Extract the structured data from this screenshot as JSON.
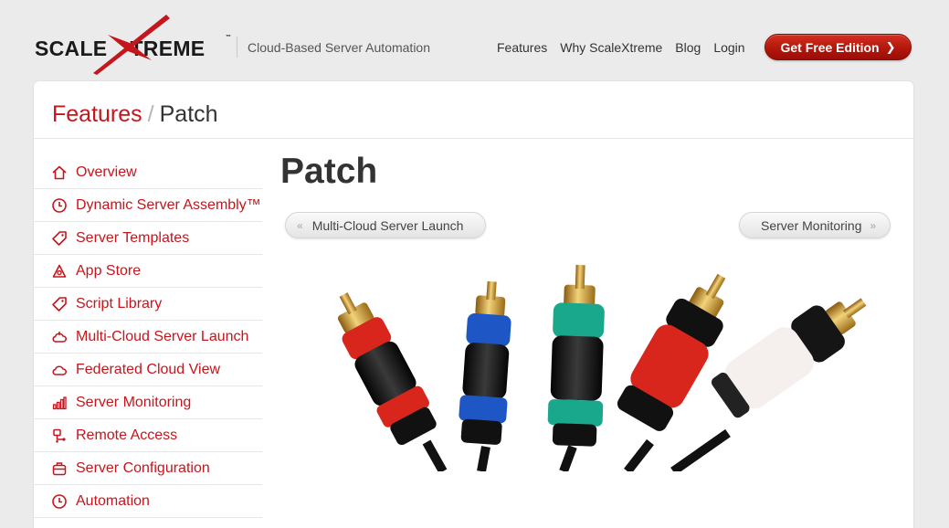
{
  "brand": {
    "name_left": "SCALE",
    "name_right": "TREME",
    "tm": "™",
    "accent_color": "#c4161c",
    "tagline": "Cloud-Based Server Automation"
  },
  "topnav": {
    "items": [
      "Features",
      "Why ScaleXtreme",
      "Blog",
      "Login"
    ],
    "cta_label": "Get Free Edition",
    "cta_icon": "chevron-right-icon"
  },
  "breadcrumb": {
    "parent": "Features",
    "separator": "/",
    "current": "Patch"
  },
  "sidebar": {
    "items": [
      {
        "label": "Overview",
        "icon": "home-icon"
      },
      {
        "label": "Dynamic Server Assembly™",
        "icon": "clock-icon"
      },
      {
        "label": "Server Templates",
        "icon": "tag-icon"
      },
      {
        "label": "App Store",
        "icon": "apps-icon"
      },
      {
        "label": "Script Library",
        "icon": "tag-icon"
      },
      {
        "label": "Multi-Cloud Server Launch",
        "icon": "cloud-launch-icon"
      },
      {
        "label": "Federated Cloud View",
        "icon": "cloud-icon"
      },
      {
        "label": "Server Monitoring",
        "icon": "bar-chart-icon"
      },
      {
        "label": "Remote Access",
        "icon": "remote-access-icon"
      },
      {
        "label": "Server Configuration",
        "icon": "toolbox-icon"
      },
      {
        "label": "Automation",
        "icon": "clock-icon"
      }
    ]
  },
  "main": {
    "title": "Patch",
    "prev_label": "Multi-Cloud Server Launch",
    "next_label": "Server Monitoring",
    "prev_icon": "double-chevron-left-icon",
    "next_icon": "double-chevron-right-icon",
    "hero_image": "rca-cables-image"
  }
}
